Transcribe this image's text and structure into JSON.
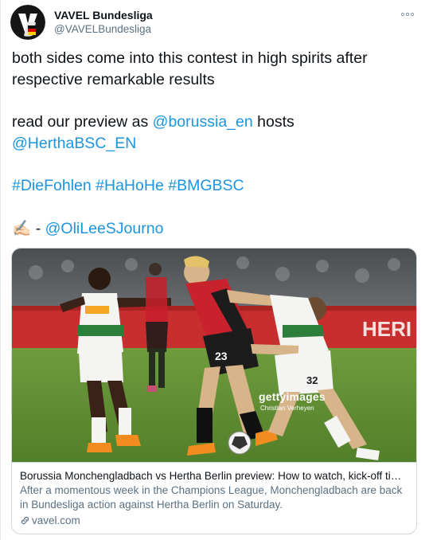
{
  "tweet": {
    "display_name": "VAVEL Bundesliga",
    "handle": "@VAVELBundesliga",
    "more_icon": "more-horizontal-icon",
    "body": {
      "line1": "both sides come into this contest in high spirits after respective remarkable results",
      "line2_prefix": "read our preview as ",
      "line2_mention1": "@borussia_en",
      "line2_mid": " hosts ",
      "line2_mention2": "@HerthaBSC_EN",
      "hashtag1": "#DieFohlen",
      "hashtag2": "#HaHoHe",
      "hashtag3": "#BMGBSC",
      "pen_emoji": "✍🏻",
      "line4_dash": " - ",
      "line4_mention": "@OliLeeSJourno"
    },
    "card": {
      "image_watermark": "gettyimages",
      "image_credit": "Christian Verheyen",
      "title": "Borussia Monchengladbach vs Hertha Berlin preview: How to watch, kick-off tim...",
      "description": "After a momentous week in the Champions League, Monchengladbach are back in Bundesliga action against Hertha Berlin on Saturday.",
      "domain": "vavel.com",
      "domain_icon": "link-icon"
    },
    "colors": {
      "link": "#1b95e0",
      "secondary_text": "#5b7083",
      "primary_text": "#0f1419",
      "border": "#cfd9de"
    }
  }
}
